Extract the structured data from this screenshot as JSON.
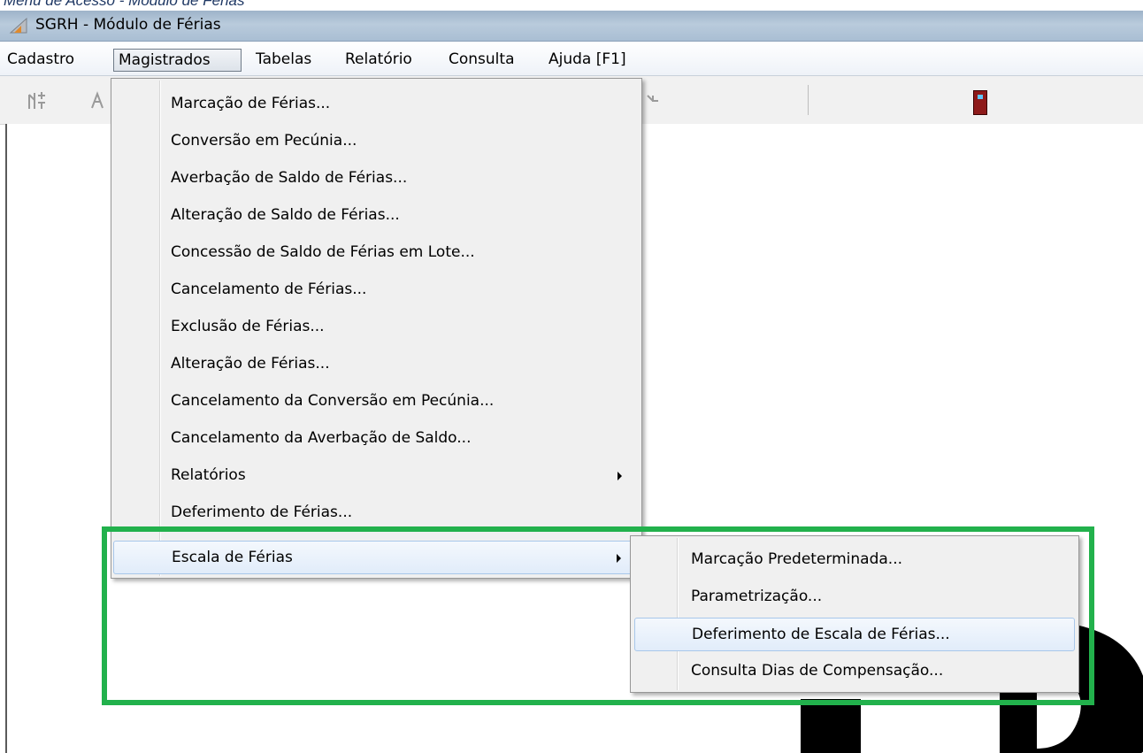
{
  "caption": "Menu de Acesso - Módulo de Férias",
  "window": {
    "title": "SGRH - Módulo de Férias",
    "app_icon": "sgrh-app-icon"
  },
  "menubar": {
    "items": [
      {
        "label": "Cadastro"
      },
      {
        "label": "Magistrados",
        "active": true
      },
      {
        "label": "Tabelas"
      },
      {
        "label": "Relatório"
      },
      {
        "label": "Consulta"
      },
      {
        "label": "Ajuda [F1]"
      }
    ]
  },
  "toolbar": {
    "icons": [
      "new-record-icon",
      "edit-record-icon",
      "tool-icon",
      "exit-door-icon"
    ]
  },
  "dropdown": {
    "items": [
      {
        "label": "Marcação de Férias..."
      },
      {
        "label": "Conversão em Pecúnia..."
      },
      {
        "label": "Averbação de Saldo de Férias..."
      },
      {
        "label": "Alteração de Saldo de Férias..."
      },
      {
        "label": "Concessão de Saldo de Férias em Lote..."
      },
      {
        "label": "Cancelamento de Férias..."
      },
      {
        "label": "Exclusão de Férias..."
      },
      {
        "label": "Alteração de Férias..."
      },
      {
        "label": "Cancelamento da Conversão em Pecúnia..."
      },
      {
        "label": "Cancelamento da Averbação de Saldo..."
      },
      {
        "label": "Relatórios",
        "submenu": true
      },
      {
        "label": "Deferimento de Férias..."
      },
      {
        "label": "Escala de Férias",
        "submenu": true,
        "highlighted": true
      }
    ]
  },
  "submenu": {
    "items": [
      {
        "label": "Marcação Predeterminada..."
      },
      {
        "label": "Parametrização..."
      },
      {
        "label": "Deferimento de Escala de Férias...",
        "highlighted": true
      },
      {
        "label": "Consulta Dias de Compensação..."
      }
    ]
  },
  "colors": {
    "highlight_box": "#22b14c",
    "title_bar": "#b9cbdc",
    "menu_background": "#f0f0f0",
    "menu_highlight": "#e1ecfa"
  }
}
